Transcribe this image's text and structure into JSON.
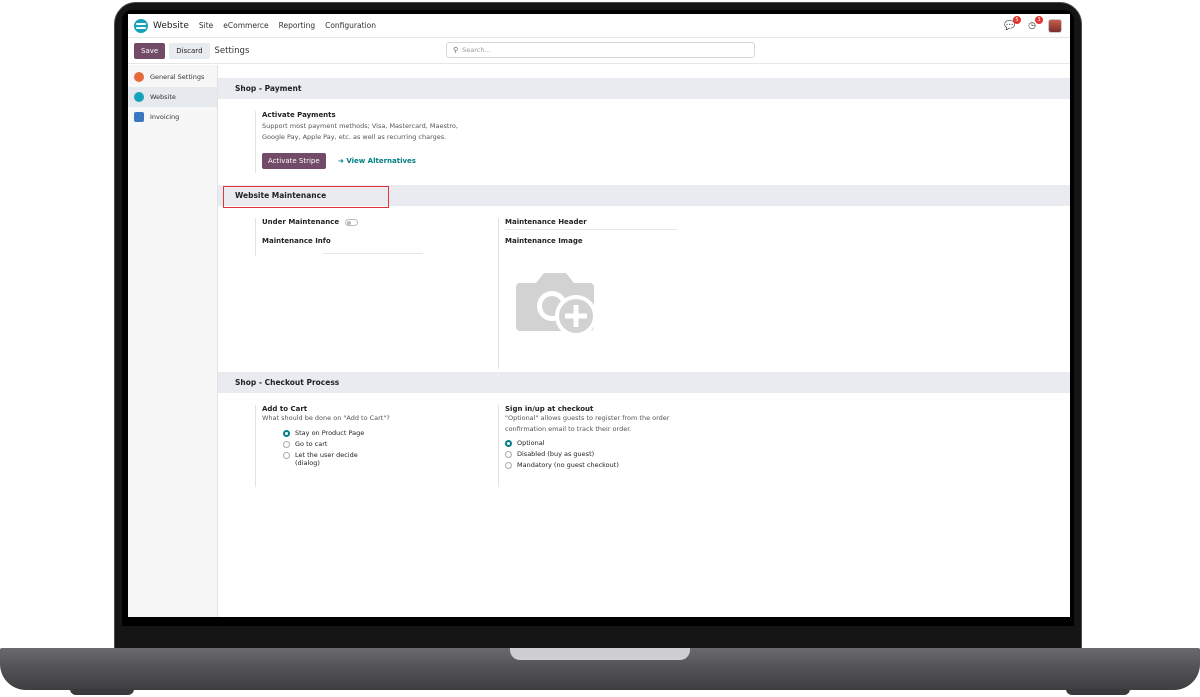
{
  "navbar": {
    "app_name": "Website",
    "menu": [
      "Site",
      "eCommerce",
      "Reporting",
      "Configuration"
    ],
    "chat_badge": "5",
    "activity_badge": "3"
  },
  "control_panel": {
    "save_label": "Save",
    "discard_label": "Discard",
    "breadcrumb": "Settings",
    "search_placeholder": "Search..."
  },
  "sidebar": {
    "items": [
      {
        "label": "General Settings",
        "icon": "general-settings-icon",
        "color": "#e66a3c"
      },
      {
        "label": "Website",
        "icon": "website-app-icon",
        "color": "#17a2b8",
        "active": true
      },
      {
        "label": "Invoicing",
        "icon": "invoicing-icon",
        "color": "#3a78c2"
      }
    ]
  },
  "payment": {
    "heading": "Shop - Payment",
    "title": "Activate Payments",
    "desc_line1": "Support most payment methods; Visa, Mastercard, Maestro,",
    "desc_line2": "Google Pay, Apple Pay, etc. as well as recurring charges.",
    "stripe_button": "Activate Stripe",
    "alternatives_link": "View Alternatives"
  },
  "maintenance": {
    "heading": "Website Maintenance",
    "under_maintenance": "Under Maintenance",
    "under_maintenance_on": false,
    "info_label": "Maintenance Info",
    "header_label": "Maintenance Header",
    "image_label": "Maintenance Image"
  },
  "checkout": {
    "heading": "Shop - Checkout Process",
    "cart_title": "Add to Cart",
    "cart_desc": "What should be done on \"Add to Cart\"?",
    "cart_options": [
      "Stay on Product Page",
      "Go to cart",
      "Let the user decide"
    ],
    "cart_option3_line2": "(dialog)",
    "signin_title": "Sign in/up at checkout",
    "signin_desc_line1": "\"Optional\" allows guests to register from the order",
    "signin_desc_line2": "confirmation email to track their order.",
    "signin_options": [
      "Optional",
      "Disabled (buy as guest)",
      "Mandatory (no guest checkout)"
    ]
  },
  "colors": {
    "brand": "#714b67",
    "accent": "#017e84",
    "highlight": "#e0353b"
  }
}
